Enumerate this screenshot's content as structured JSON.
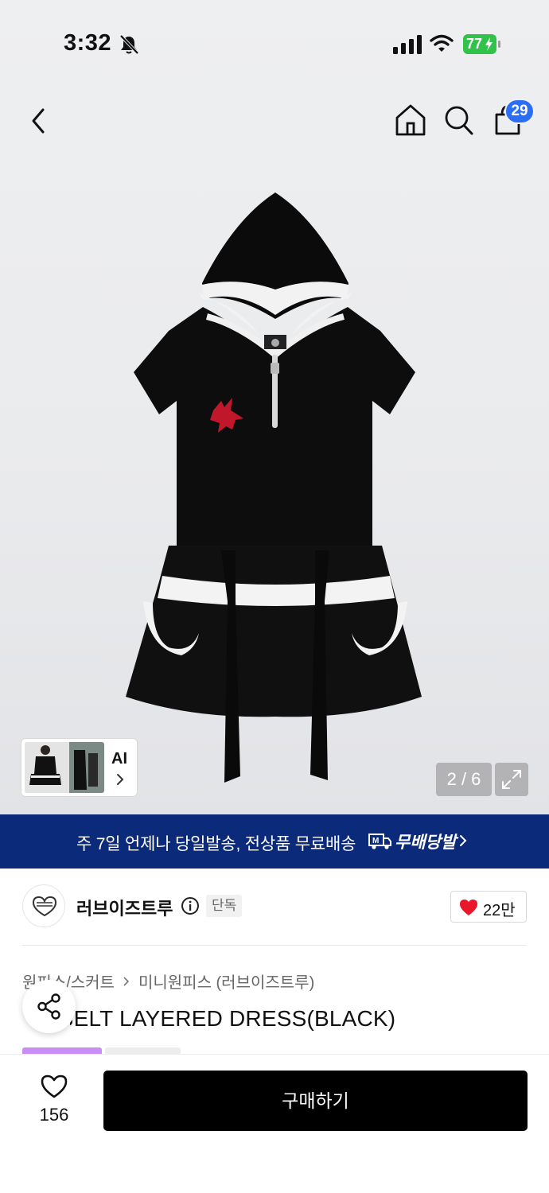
{
  "status_bar": {
    "time": "3:32",
    "battery": "77"
  },
  "nav": {
    "cart_count": "29"
  },
  "gallery": {
    "counter": "2 / 6",
    "ai_label": "AI"
  },
  "banner": {
    "text": "주 7일 언제나 당일발송, 전상품 무료배송",
    "badge_text": "무배당발"
  },
  "brand": {
    "name": "러브이즈트루",
    "exclusive_label": "단독",
    "likes": "22만"
  },
  "breadcrumb": {
    "category": "원피스/스커트",
    "subcategory": "미니원피스 (러브이즈트루)"
  },
  "product": {
    "title": "SB BELT LAYERED DRESS(BLACK)"
  },
  "bottom_bar": {
    "wish_count": "156",
    "buy_label": "구매하기"
  },
  "colors": {
    "banner_bg": "#0c2a7a",
    "badge_blue": "#2b6ef5",
    "heart_red": "#e8172c",
    "buy_bg": "#000000"
  }
}
